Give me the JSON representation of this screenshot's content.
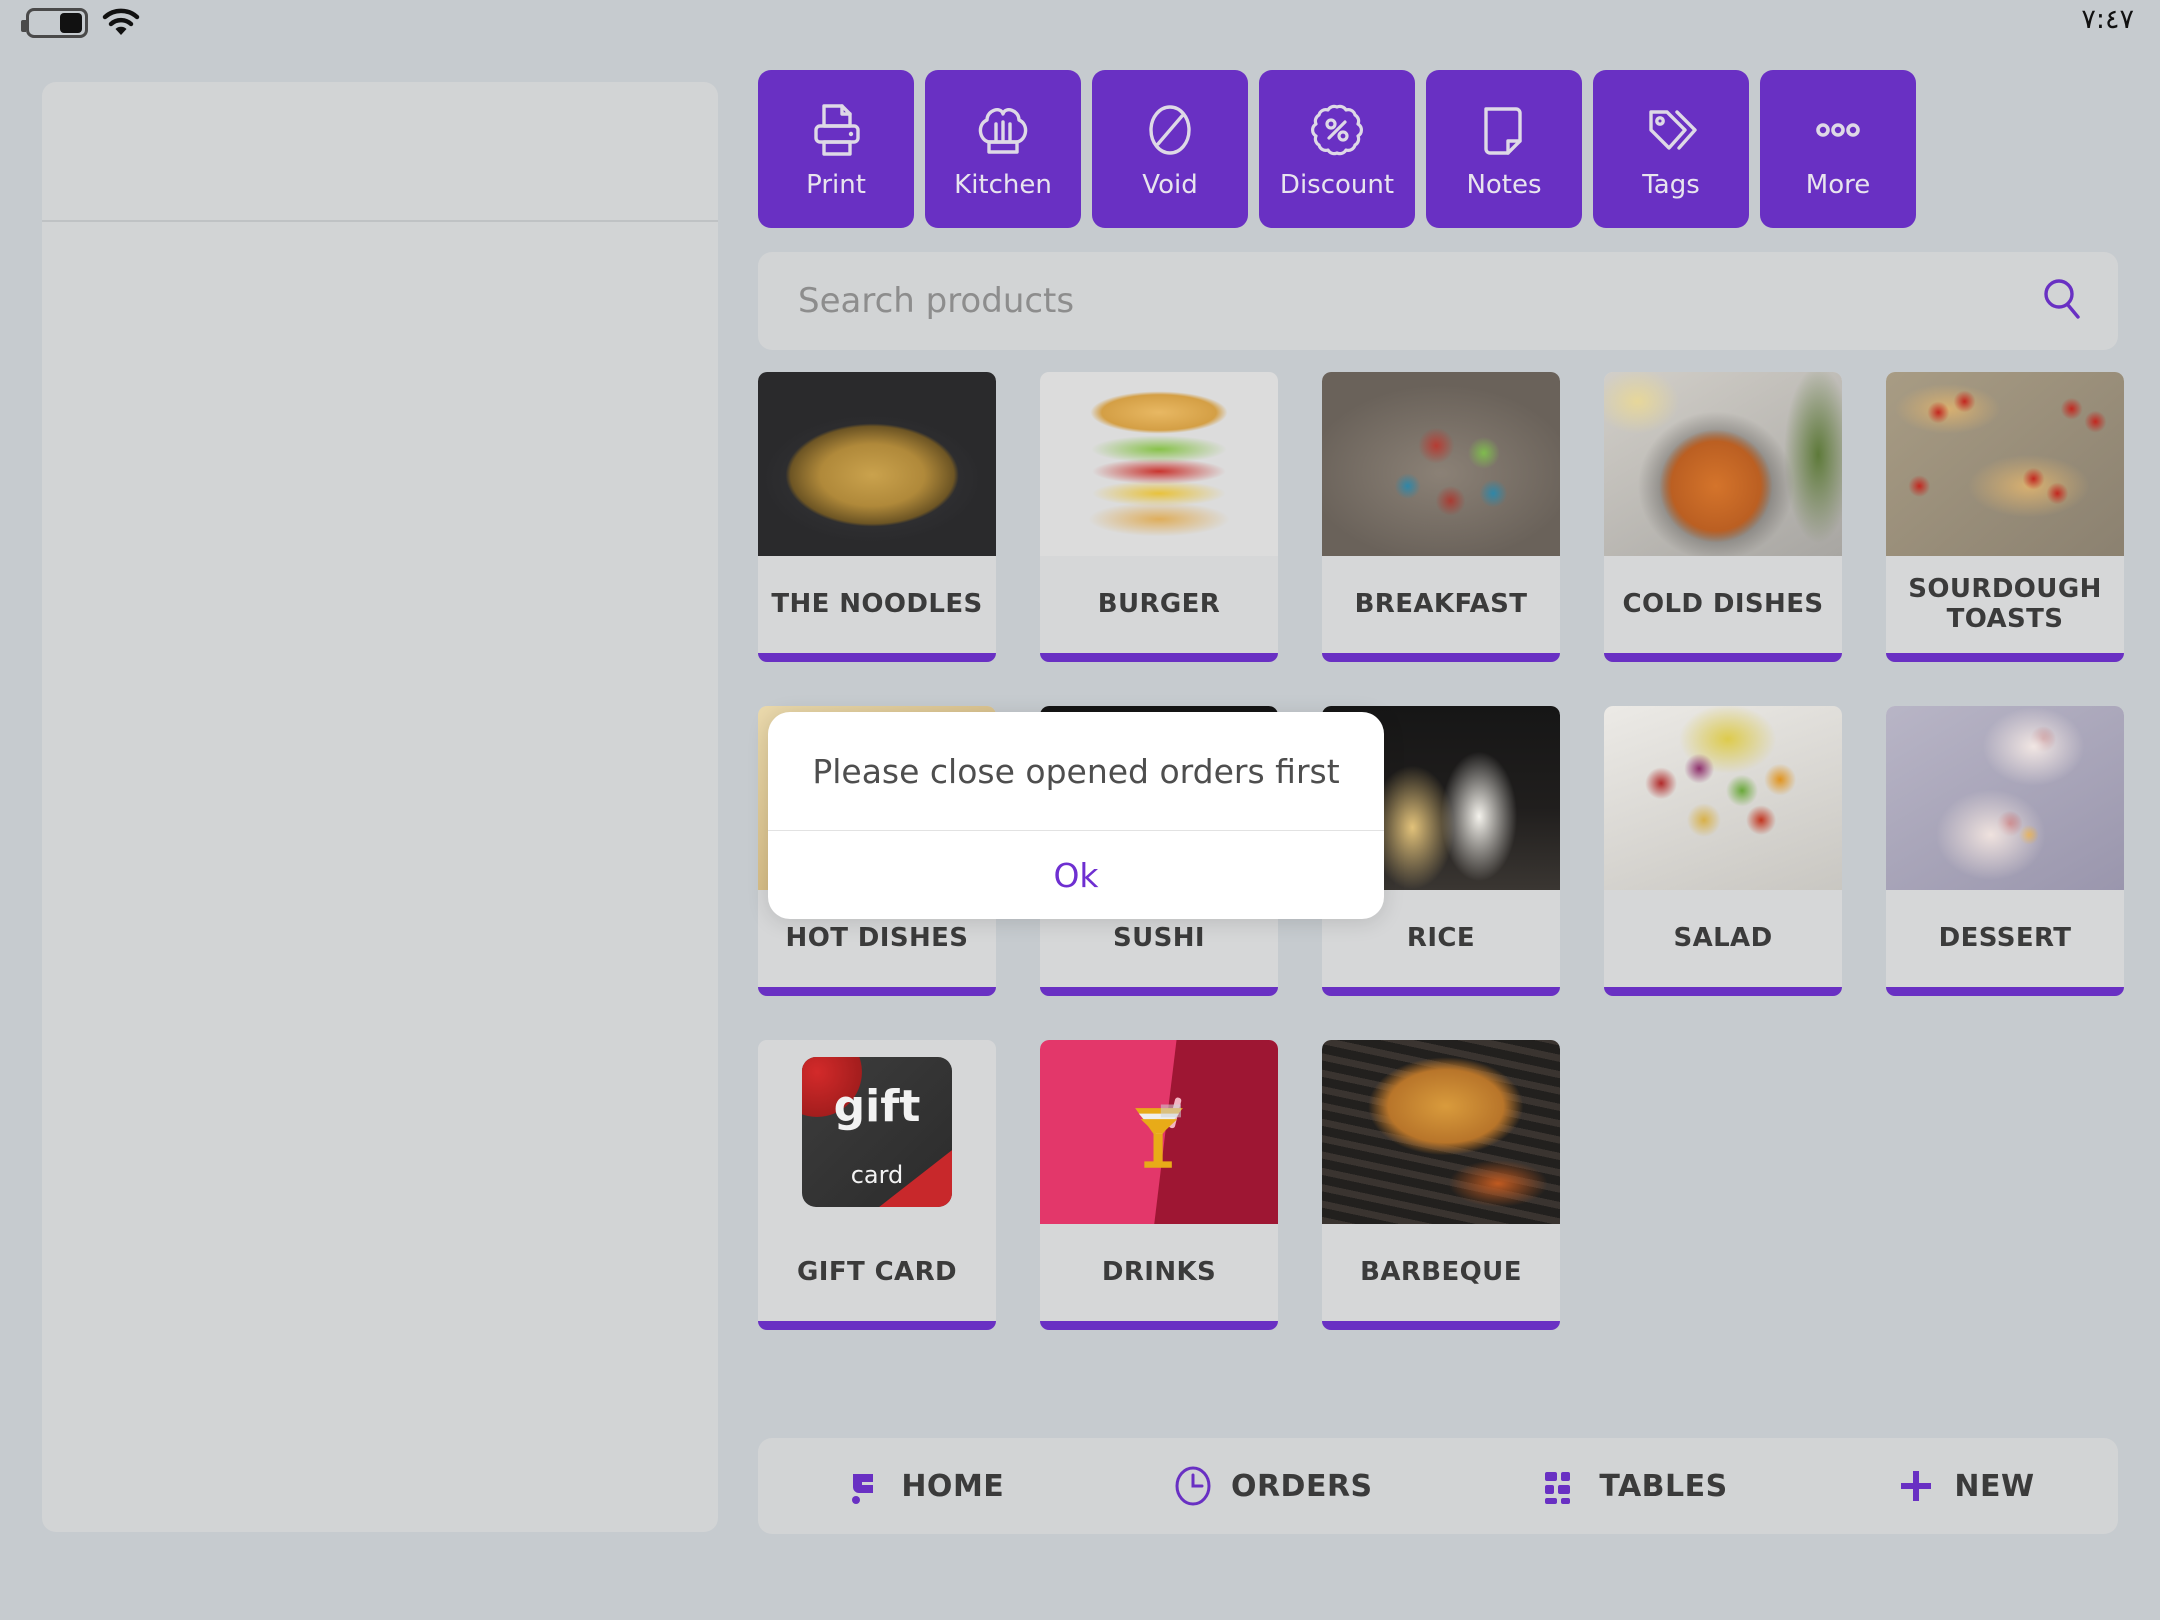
{
  "statusbar": {
    "battery_icon": "battery-low-icon",
    "wifi_icon": "wifi-icon",
    "time": "٧:٤٧"
  },
  "theme": {
    "accent": "#6930c3",
    "page_bg": "#c6cbcf",
    "panel_bg": "#d2d4d5",
    "tile_bg": "#d6d7d8",
    "text": "#3b3b3b"
  },
  "order_panel": {
    "name": "order-panel",
    "empty": true
  },
  "toolbar": {
    "buttons": [
      {
        "label": "Print",
        "icon": "printer-icon"
      },
      {
        "label": "Kitchen",
        "icon": "chef-hat-icon"
      },
      {
        "label": "Void",
        "icon": "void-circle-slash-icon"
      },
      {
        "label": "Discount",
        "icon": "discount-percent-badge-icon"
      },
      {
        "label": "Notes",
        "icon": "note-page-icon"
      },
      {
        "label": "Tags",
        "icon": "tags-icon"
      },
      {
        "label": "More",
        "icon": "more-dots-icon"
      }
    ]
  },
  "search": {
    "placeholder": "Search products",
    "value": "",
    "icon": "search-icon"
  },
  "products": {
    "categories": [
      {
        "label": "THE NOODLES",
        "image": "noodles-photo"
      },
      {
        "label": "BURGER",
        "image": "burger-photo"
      },
      {
        "label": "BREAKFAST",
        "image": "breakfast-platter-photo"
      },
      {
        "label": "COLD DISHES",
        "image": "cold-dishes-skillet-photo"
      },
      {
        "label": "SOURDOUGH TOASTS",
        "image": "sourdough-toasts-photo"
      },
      {
        "label": "HOT DISHES",
        "image": "hot-dishes-photo"
      },
      {
        "label": "SUSHI",
        "image": "sushi-photo"
      },
      {
        "label": "RICE",
        "image": "onigiri-rice-photo"
      },
      {
        "label": "SALAD",
        "image": "salad-bowl-photo"
      },
      {
        "label": "DESSERT",
        "image": "dessert-pavlova-photo"
      },
      {
        "label": "GIFT CARD",
        "image": "gift-card-photo"
      },
      {
        "label": "DRINKS",
        "image": "cocktail-illustration"
      },
      {
        "label": "BARBEQUE",
        "image": "barbeque-grill-photo"
      }
    ]
  },
  "bottom_nav": {
    "items": [
      {
        "label": "HOME",
        "icon": "brand-home-icon"
      },
      {
        "label": "ORDERS",
        "icon": "clock-icon"
      },
      {
        "label": "TABLES",
        "icon": "grid-tables-icon"
      },
      {
        "label": "NEW",
        "icon": "plus-icon"
      }
    ]
  },
  "modal": {
    "message": "Please close opened orders first",
    "ok_label": "Ok"
  }
}
